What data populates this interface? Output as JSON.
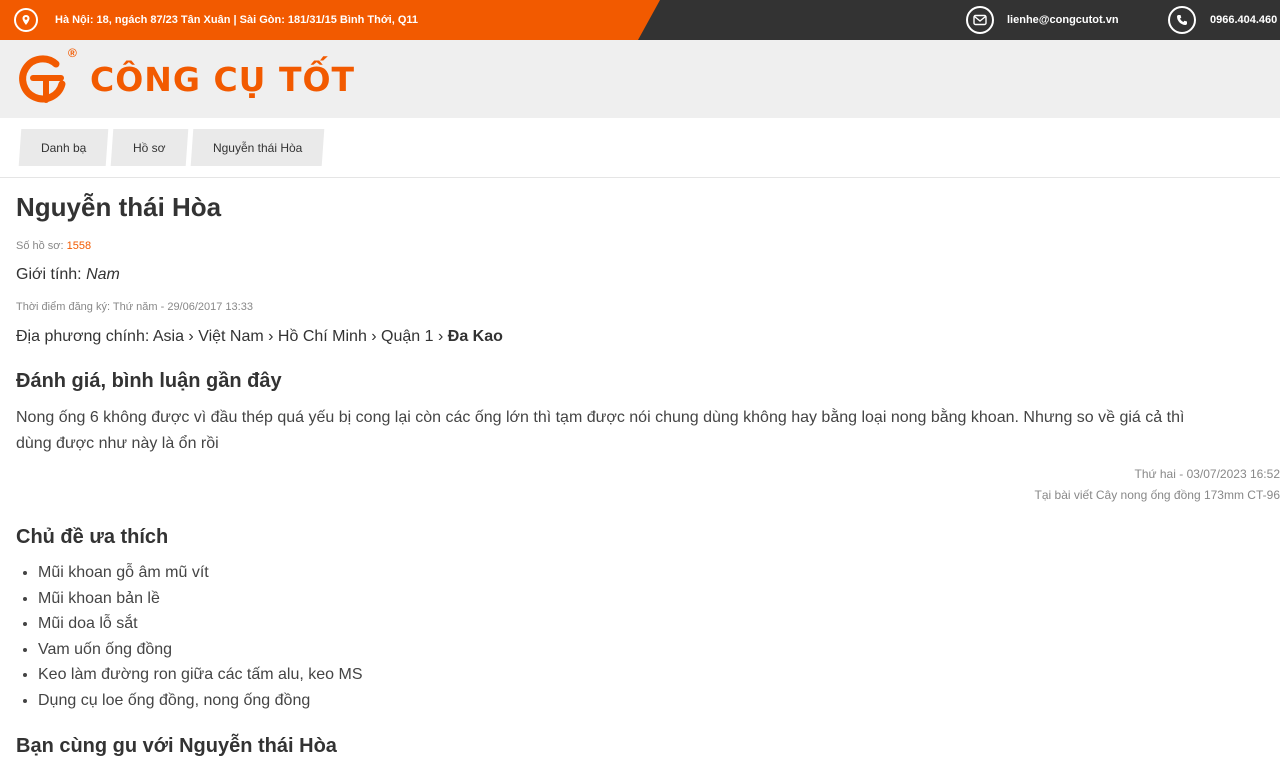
{
  "topbar": {
    "address": "Hà Nội: 18, ngách 87/23 Tân Xuân | Sài Gòn: 181/31/15 Bình Thới, Q11",
    "email": "lienhe@congcutot.vn",
    "phone": "0966.404.460"
  },
  "brand": {
    "name": "CÔNG CỤ TỐT",
    "registered": "®",
    "color": "#f25a00"
  },
  "breadcrumb": [
    "Danh bạ",
    "Hồ sơ",
    "Nguyễn thái Hòa"
  ],
  "profile": {
    "name": "Nguyễn thái Hòa",
    "profile_no_label": "Số hồ sơ:",
    "profile_no": "1558",
    "gender_label": "Giới tính:",
    "gender": "Nam",
    "registered": "Thời điểm đăng ký: Thứ năm - 29/06/2017 13:33",
    "location_label": "Địa phương chính:",
    "location_path": "Asia › Việt Nam › Hồ Chí Minh › Quận 1 ›",
    "location_last": "Đa Kao"
  },
  "reviews_section": {
    "title": "Đánh giá, bình luận gần đây",
    "line1": "Nong ống 6 không được vì đầu thép quá yếu bị cong lại còn các ống lớn thì tạm được nói chung dùng không hay bằng loại nong bằng khoan. Nhưng so về giá cả thì",
    "line2": "dùng được như này là ổn rồi",
    "date": "Thứ hai - 03/07/2023 16:52",
    "source": "Tại bài viết Cây nong ống đồng 173mm CT-96"
  },
  "favorites": {
    "title": "Chủ đề ưa thích",
    "items": [
      "Mũi khoan gỗ âm mũ vít",
      "Mũi khoan bản lề",
      "Mũi doa lỗ sắt",
      "Vam uốn ống đồng",
      "Keo làm đường ron giữa các tấm alu, keo MS",
      "Dụng cụ loe ống đồng, nong ống đồng"
    ]
  },
  "similar": {
    "title": "Bạn cùng gu với Nguyễn thái Hòa"
  }
}
